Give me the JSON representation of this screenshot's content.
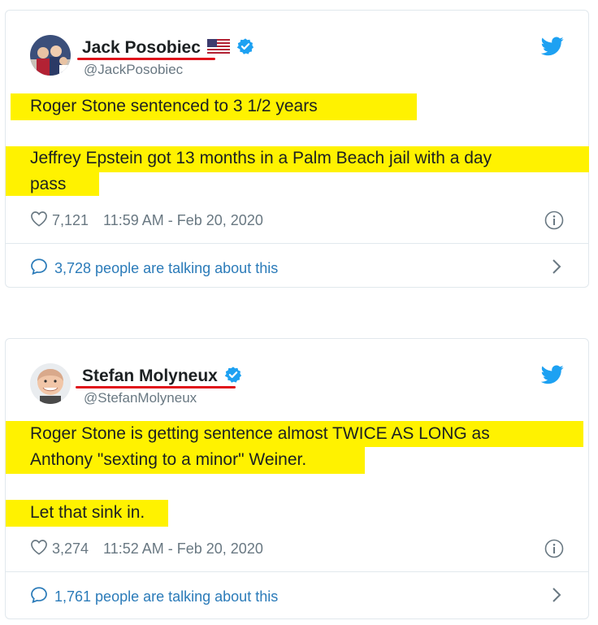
{
  "tweets": [
    {
      "name": "Jack Posobiec",
      "handle": "@JackPosobiec",
      "lines": [
        "Roger Stone sentenced to 3 1/2 years",
        "Jeffrey Epstein got 13 months in a Palm Beach jail with a day",
        "pass"
      ],
      "likes": "7,121",
      "time": "11:59 AM - Feb 20, 2020",
      "talking": "3,728 people are talking about this"
    },
    {
      "name": "Stefan Molyneux",
      "handle": "@StefanMolyneux",
      "lines": [
        "Roger Stone is getting sentence almost TWICE AS LONG as",
        "Anthony \"sexting to a minor\" Weiner.",
        "Let that sink in."
      ],
      "likes": "3,274",
      "time": "11:52 AM - Feb 20, 2020",
      "talking": "1,761 people are talking about this"
    }
  ],
  "colors": {
    "highlight": "#fff200",
    "underline": "#e0121b",
    "twitter_blue": "#1da1f2",
    "link": "#2b7bb9",
    "muted": "#697882"
  },
  "icons": [
    "us-flag-icon",
    "verified-badge-icon",
    "twitter-bird-icon",
    "heart-icon",
    "info-icon",
    "speech-bubble-icon",
    "chevron-right-icon"
  ]
}
